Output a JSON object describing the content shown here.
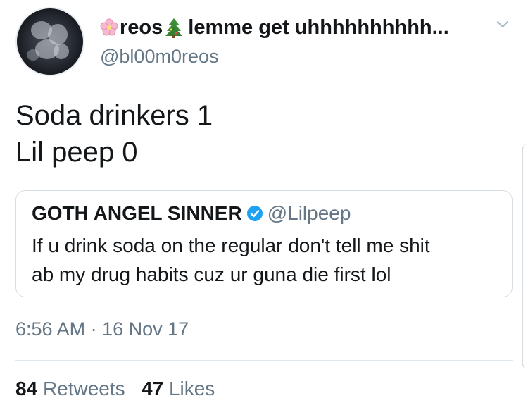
{
  "tweet": {
    "display_name": "reos",
    "display_name_suffix": "lemme get uhhhhhhhhhh...",
    "handle": "@bl00m0reos",
    "text_line1": "Soda drinkers 1",
    "text_line2": "Lil peep 0",
    "timestamp": "6:56 AM · 16 Nov 17",
    "retweet_count": "84",
    "retweet_label": "Retweets",
    "like_count": "47",
    "like_label": "Likes"
  },
  "quoted_tweet": {
    "display_name": "GOTH ANGEL SINNER",
    "handle": "@Lilpeep",
    "verified": true,
    "text_line1": "If u drink soda on the regular don't tell me shit",
    "text_line2": "ab my drug habits cuz ur guna die first lol"
  },
  "icons": {
    "name_prefix": "cherry-blossom-icon",
    "name_mid": "christmas-tree-icon",
    "menu": "chevron-down-icon",
    "verified": "verified-badge-icon"
  },
  "colors": {
    "text_primary": "#14171a",
    "text_secondary": "#657786",
    "verified_blue": "#1da1f2",
    "border": "#d6dde3"
  }
}
